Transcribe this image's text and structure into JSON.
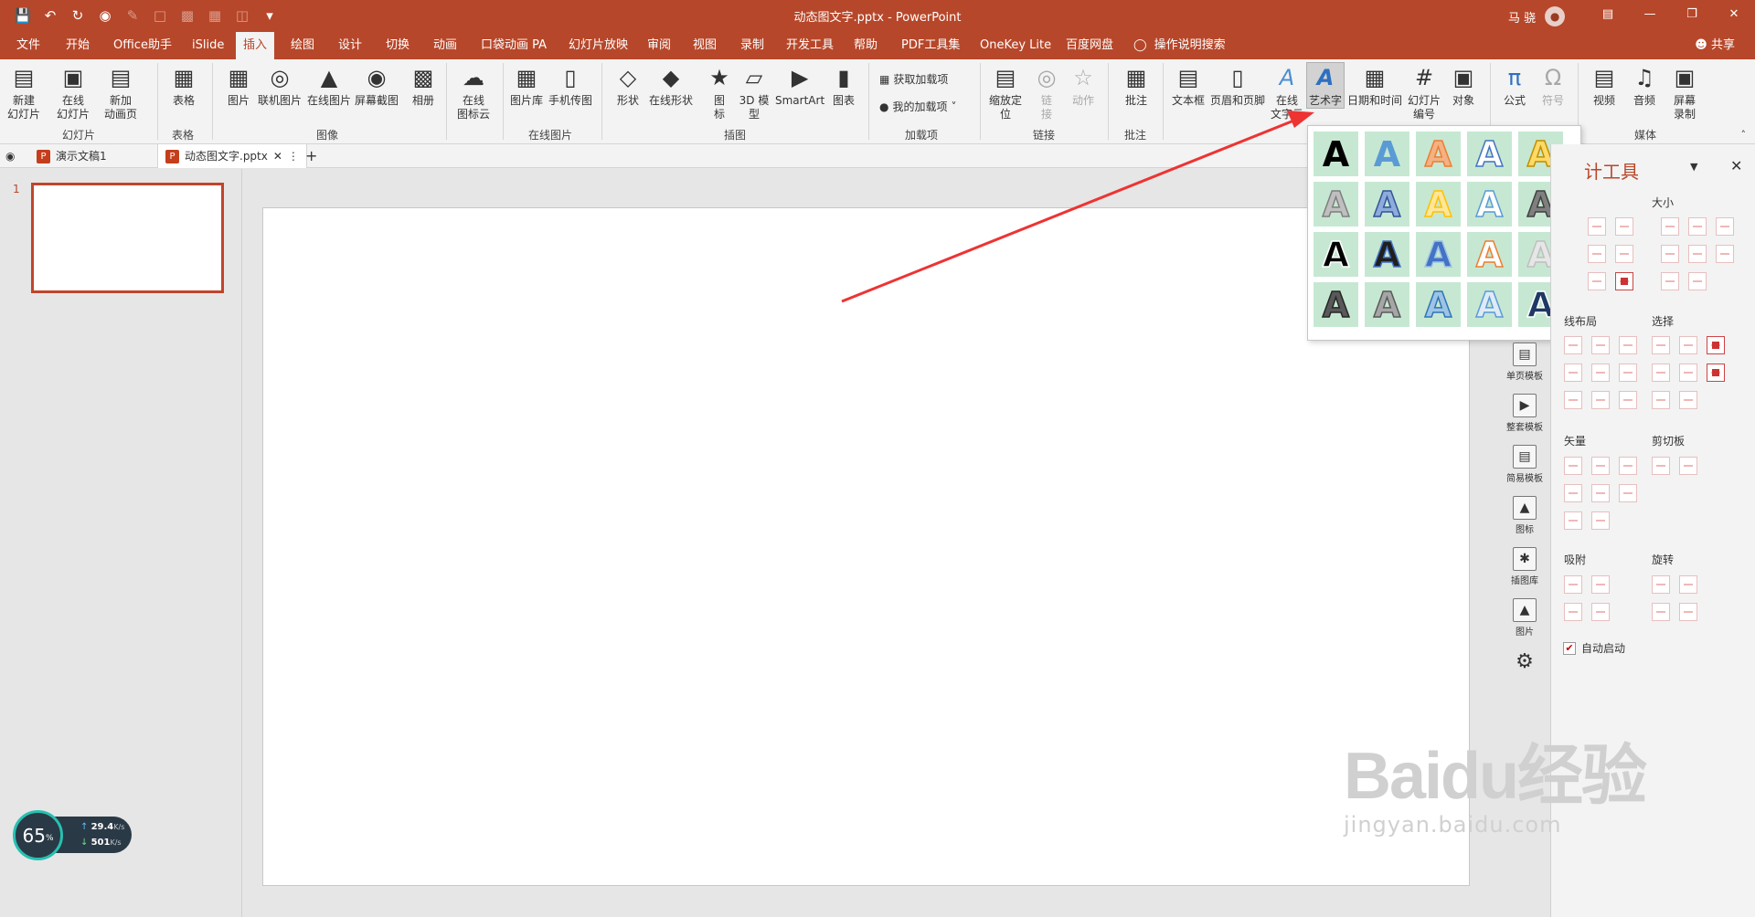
{
  "window": {
    "title": "动态图文字.pptx  -  PowerPoint",
    "user": "马 骁",
    "share": "共享",
    "tell_me": "操作说明搜索"
  },
  "tabs": [
    "文件",
    "开始",
    "Office助手",
    "iSlide",
    "插入",
    "绘图",
    "设计",
    "切换",
    "动画",
    "口袋动画 PA",
    "幻灯片放映",
    "审阅",
    "视图",
    "录制",
    "开发工具",
    "帮助",
    "PDF工具集",
    "OneKey Lite",
    "百度网盘"
  ],
  "active_tab": "插入",
  "ribbon": {
    "buttons": [
      "新建\n幻灯片",
      "在线\n幻灯片",
      "新加\n动画页",
      "表格",
      "图片",
      "联机图片",
      "在线图片",
      "屏幕截图",
      "相册",
      "在线\n图标云",
      "图片库",
      "手机传图",
      "形状",
      "在线形状",
      "图\n标",
      "3D 模\n型",
      "SmartArt",
      "图表",
      "缩放定\n位",
      "链\n接",
      "动作",
      "批注",
      "文本框",
      "页眉和页脚",
      "在线\n文字云",
      "艺术字",
      "日期和时间",
      "幻灯片\n编号",
      "对象",
      "公式",
      "符号",
      "视频",
      "音频",
      "屏幕\n录制"
    ],
    "addins": [
      "获取加载项",
      "我的加载项"
    ],
    "groups": [
      "幻灯片",
      "表格",
      "图像",
      "在线图片",
      "插图",
      "加载项",
      "链接",
      "批注",
      "媒体"
    ]
  },
  "doc_tabs": [
    "演示文稿1",
    "动态图文字.pptx"
  ],
  "slide_numbers": [
    "1"
  ],
  "wordart": {
    "colors": [
      {
        "fill": "#000000",
        "stroke": "none"
      },
      {
        "fill": "#5b9bd5",
        "stroke": "none"
      },
      {
        "fill": "#f4b183",
        "stroke": "#ed7d31"
      },
      {
        "fill": "#ffffff",
        "stroke": "#4472c4"
      },
      {
        "fill": "#ffd966",
        "stroke": "#bf9000"
      },
      {
        "fill": "#bfbfbf",
        "stroke": "#7f7f7f"
      },
      {
        "fill": "#8faadc",
        "stroke": "#2f5597"
      },
      {
        "fill": "#ffe699",
        "stroke": "#ffc000"
      },
      {
        "fill": "#ffffff",
        "stroke": "#5b9bd5"
      },
      {
        "fill": "#7f7f7f",
        "stroke": "#404040"
      },
      {
        "fill": "#000000",
        "stroke": "#ffffff"
      },
      {
        "fill": "#1f1f1f",
        "stroke": "#4472c4"
      },
      {
        "fill": "#4472c4",
        "stroke": "#9dc3e6"
      },
      {
        "fill": "#ffffff",
        "stroke": "#ed7d31"
      },
      {
        "fill": "#e7e6e6",
        "stroke": "#bfbfbf"
      },
      {
        "fill": "#595959",
        "stroke": "#262626"
      },
      {
        "fill": "#a6a6a6",
        "stroke": "#595959"
      },
      {
        "fill": "#9dc3e6",
        "stroke": "#2e75b6"
      },
      {
        "fill": "#deebf7",
        "stroke": "#5b9bd5"
      },
      {
        "fill": "#1f3864",
        "stroke": "#ffffff"
      }
    ]
  },
  "side_strip": [
    "单页模板",
    "整套模板",
    "简易模板",
    "图标",
    "插图库",
    "图片"
  ],
  "design_panel": {
    "title": "计工具",
    "sections": [
      "大小",
      "线布局",
      "选择",
      "矢量",
      "剪切板",
      "吸附",
      "旋转"
    ],
    "auto_start": "自动启动",
    "auto_start_checked": true
  },
  "net_widget": {
    "percent": "65",
    "unit": "%",
    "up": "29.4",
    "down": "501",
    "rate_unit": "K/s"
  },
  "watermark": {
    "brand": "Baidu经验",
    "url": "jingyan.baidu.com"
  }
}
